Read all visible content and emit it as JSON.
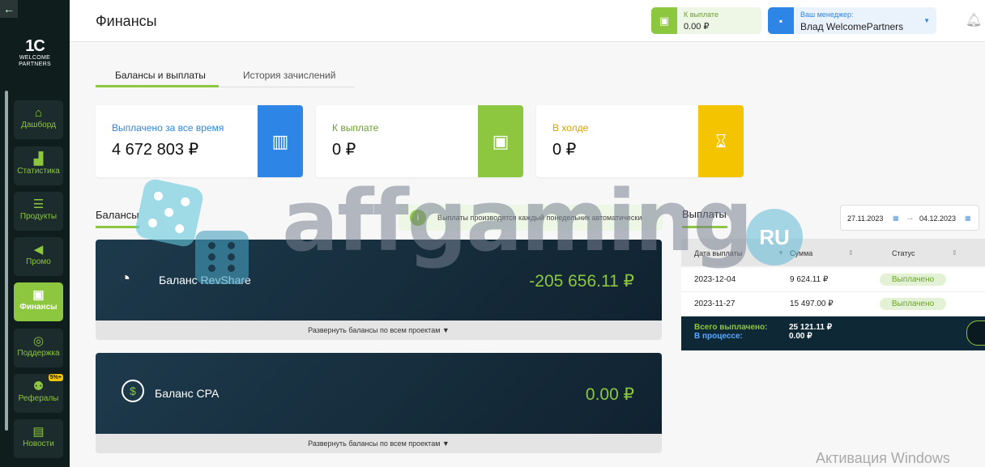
{
  "sidebar": {
    "back_icon": "arrow-left-icon",
    "logo": {
      "mark": "1C",
      "line1": "WELCOME",
      "line2": "PARTNERS"
    },
    "items": [
      {
        "label": "Дашборд",
        "icon": "home-icon"
      },
      {
        "label": "Статистика",
        "icon": "bar-chart-icon"
      },
      {
        "label": "Продукты",
        "icon": "list-icon"
      },
      {
        "label": "Промо",
        "icon": "megaphone-icon"
      },
      {
        "label": "Финансы",
        "icon": "wallet-icon",
        "active": true
      },
      {
        "label": "Поддержка",
        "icon": "lifebuoy-icon"
      },
      {
        "label": "Рефералы",
        "icon": "add-user-icon",
        "badge": "5%+"
      },
      {
        "label": "Новости",
        "icon": "newspaper-icon"
      }
    ]
  },
  "header": {
    "title": "Финансы",
    "payout": {
      "label": "К выплате",
      "value": "0.00 ₽"
    },
    "manager": {
      "label": "Ваш менеджер:",
      "value": "Влад WelcomePartners"
    }
  },
  "tabs": [
    {
      "label": "Балансы и выплаты",
      "active": true
    },
    {
      "label": "История зачислений",
      "active": false
    }
  ],
  "stats": [
    {
      "label": "Выплачено за все время",
      "value": "4 672 803 ₽",
      "color": "#2d86e6",
      "label_color": "#2d86e6",
      "icon": "atm-icon"
    },
    {
      "label": "К выплате",
      "value": "0 ₽",
      "color": "#8dc63f",
      "label_color": "#6aa12a",
      "icon": "wallet-icon"
    },
    {
      "label": "В холде",
      "value": "0 ₽",
      "color": "#f5c400",
      "label_color": "#d4a400",
      "icon": "hourglass-icon"
    }
  ],
  "balances": {
    "section_label": "Балансы",
    "info": "Выплаты производятся каждый понедельник автоматически",
    "items": [
      {
        "name": "Баланс RevShare",
        "amount": "-205 656.11 ₽",
        "icon": "pie-chart-icon",
        "expand": "Развернуть балансы по всем проектам"
      },
      {
        "name": "Баланс CPA",
        "amount": "0.00 ₽",
        "icon": "dollar-cycle-icon",
        "expand": "Развернуть балансы по всем проектам"
      }
    ]
  },
  "payouts": {
    "section_label": "Выплаты",
    "date_from": "27.11.2023",
    "date_to": "04.12.2023",
    "columns": [
      "Дата выплаты",
      "Сумма",
      "Статус"
    ],
    "rows": [
      {
        "date": "2023-12-04",
        "amount": "9 624.11 ₽",
        "status": "Выплачено"
      },
      {
        "date": "2023-11-27",
        "amount": "15 497.00 ₽",
        "status": "Выплачено"
      }
    ],
    "total_label": "Всего выплачено:",
    "total_value": "25 121.11 ₽",
    "pending_label": "В процессе:",
    "pending_value": "0.00 ₽"
  },
  "watermark": {
    "text": "affgaming",
    "badge": "RU"
  },
  "os_notice": "Активация Windows"
}
